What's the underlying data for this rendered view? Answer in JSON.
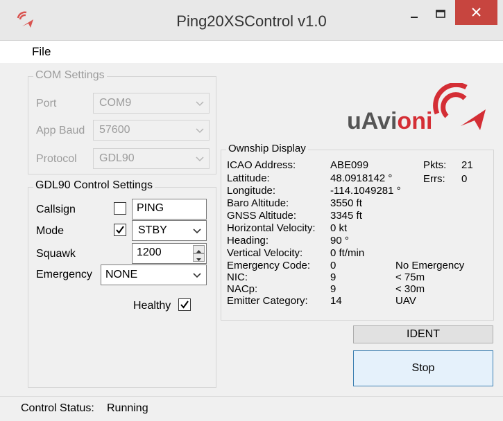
{
  "window": {
    "title": "Ping20XSControl v1.0"
  },
  "menu": {
    "file": "File"
  },
  "logo": {
    "text_main": "uAvi",
    "text_accent": "oni",
    "accent_color": "#d42e35",
    "dark_color": "#555555"
  },
  "com_settings": {
    "legend": "COM Settings",
    "port_label": "Port",
    "port_value": "COM9",
    "baud_label": "App Baud",
    "baud_value": "57600",
    "protocol_label": "Protocol",
    "protocol_value": "GDL90"
  },
  "gdl90": {
    "legend": "GDL90 Control Settings",
    "callsign_label": "Callsign",
    "callsign_value": "PING",
    "callsign_checked": false,
    "mode_label": "Mode",
    "mode_value": "STBY",
    "mode_checked": true,
    "squawk_label": "Squawk",
    "squawk_value": "1200",
    "emergency_label": "Emergency",
    "emergency_value": "NONE",
    "healthy_label": "Healthy",
    "healthy_checked": true
  },
  "ownship": {
    "legend": "Ownship Display",
    "pkts_label": "Pkts:",
    "pkts_value": "21",
    "errs_label": "Errs:",
    "errs_value": "0",
    "rows": [
      {
        "label": "ICAO Address:",
        "value": "ABE099",
        "extra": ""
      },
      {
        "label": "Lattitude:",
        "value": "48.0918142 °",
        "extra": ""
      },
      {
        "label": "Longitude:",
        "value": "-114.1049281 °",
        "extra": ""
      },
      {
        "label": "Baro Altitude:",
        "value": "3550 ft",
        "extra": ""
      },
      {
        "label": "GNSS Altitude:",
        "value": "3345 ft",
        "extra": ""
      },
      {
        "label": "Horizontal Velocity:",
        "value": "0 kt",
        "extra": ""
      },
      {
        "label": "Heading:",
        "value": "90 °",
        "extra": ""
      },
      {
        "label": "Vertical Velocity:",
        "value": "0 ft/min",
        "extra": ""
      },
      {
        "label": "Emergency Code:",
        "value": "0",
        "extra": "No Emergency"
      },
      {
        "label": "NIC:",
        "value": "9",
        "extra": "< 75m"
      },
      {
        "label": "NACp:",
        "value": "9",
        "extra": "< 30m"
      },
      {
        "label": "Emitter Category:",
        "value": "14",
        "extra": "UAV"
      }
    ]
  },
  "buttons": {
    "ident": "IDENT",
    "stop": "Stop"
  },
  "status": {
    "label": "Control Status:",
    "value": "Running"
  }
}
